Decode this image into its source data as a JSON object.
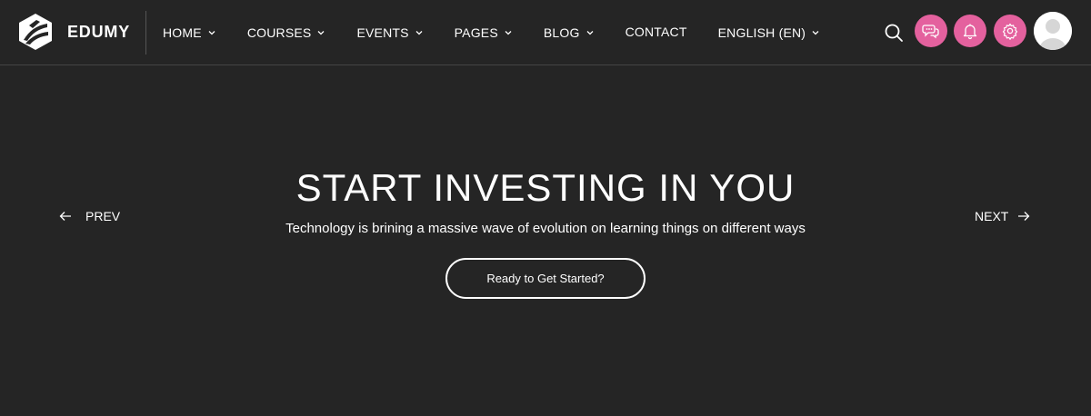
{
  "brand": {
    "name": "EDUMY",
    "logo_icon": "edumy-logo-icon"
  },
  "nav": {
    "items": [
      {
        "label": "HOME",
        "has_dropdown": true
      },
      {
        "label": "COURSES",
        "has_dropdown": true
      },
      {
        "label": "EVENTS",
        "has_dropdown": true
      },
      {
        "label": "PAGES",
        "has_dropdown": true
      },
      {
        "label": "BLOG",
        "has_dropdown": true
      },
      {
        "label": "CONTACT",
        "has_dropdown": false
      },
      {
        "label": "ENGLISH (EN)",
        "has_dropdown": true
      }
    ]
  },
  "header_actions": {
    "search_icon": "search-icon",
    "buttons": [
      {
        "icon": "chat-icon"
      },
      {
        "icon": "notification-bell-icon"
      },
      {
        "icon": "settings-gear-icon"
      }
    ],
    "avatar_icon": "user-avatar-icon",
    "accent_color": "#e4619e"
  },
  "hero": {
    "title": "START INVESTING IN YOU",
    "subtitle": "Technology is brining a massive wave of evolution on learning things on different ways",
    "cta_label": "Ready to Get Started?",
    "prev_label": "PREV",
    "next_label": "NEXT"
  },
  "colors": {
    "background": "#252525",
    "text": "#ffffff",
    "divider": "#444444"
  }
}
